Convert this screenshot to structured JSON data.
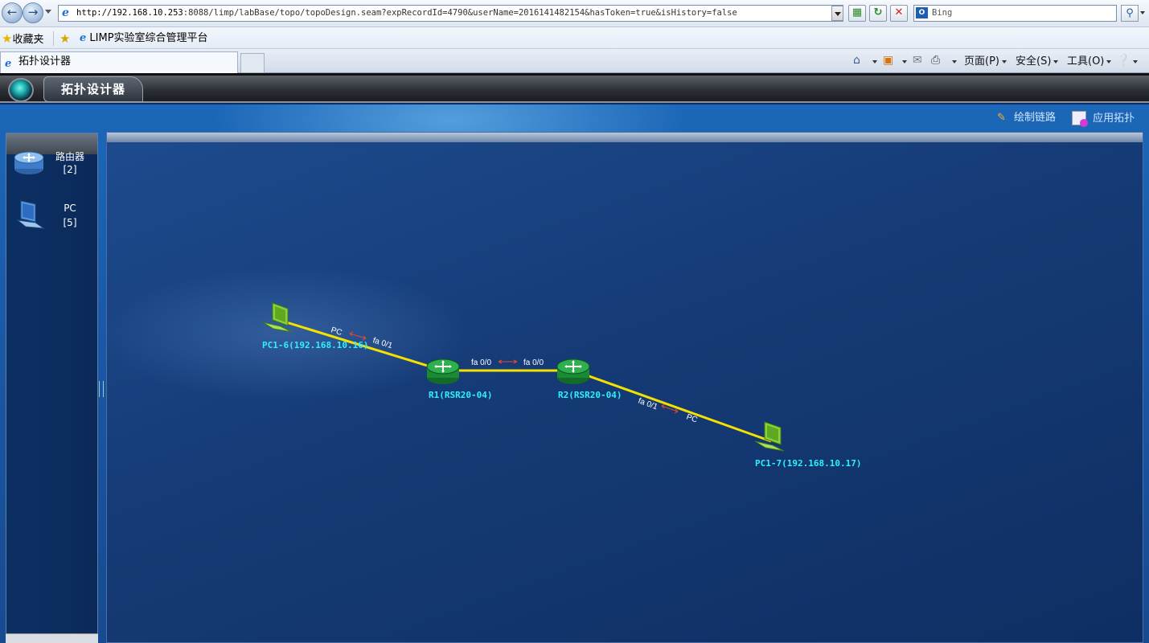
{
  "browser": {
    "url_host": "http://192.168.10.253",
    "url_rest": ":8088/limp/labBase/topo/topoDesign.seam?expRecordId=4790&userName=2016141482154&hasToken=true&isHistory=false",
    "search_placeholder": "Bing",
    "favorites_label": "收藏夹",
    "favorite_link": "LIMP实验室综合管理平台",
    "tab_title": "拓扑设计器",
    "menu": {
      "page": "页面(P)",
      "safety": "安全(S)",
      "tools": "工具(O)"
    }
  },
  "app": {
    "title": "拓扑设计器",
    "toolbar": {
      "draw_link": "绘制链路",
      "apply_topo": "应用拓扑"
    },
    "palette": [
      {
        "name": "路由器",
        "count": "[2]",
        "icon": "router-icon"
      },
      {
        "name": "PC",
        "count": "[5]",
        "icon": "pc-icon"
      }
    ]
  },
  "topology": {
    "nodes": [
      {
        "id": "pc1",
        "label": "PC1-6(192.168.10.16)",
        "type": "pc"
      },
      {
        "id": "r1",
        "label": "R1(RSR20-04)",
        "type": "router"
      },
      {
        "id": "r2",
        "label": "R2(RSR20-04)",
        "type": "router"
      },
      {
        "id": "pc2",
        "label": "PC1-7(192.168.10.17)",
        "type": "pc"
      }
    ],
    "links": [
      {
        "from": "pc1",
        "to": "r1",
        "from_port": "PC",
        "to_port": "fa 0/1"
      },
      {
        "from": "r1",
        "to": "r2",
        "from_port": "fa 0/0",
        "to_port": "fa 0/0"
      },
      {
        "from": "r2",
        "to": "pc2",
        "from_port": "fa 0/1",
        "to_port": "PC"
      }
    ],
    "colors": {
      "link": "#f5e100",
      "node_label": "#2ff0ff",
      "router": "#1e9a3c",
      "pc": "#7cc22a"
    }
  }
}
